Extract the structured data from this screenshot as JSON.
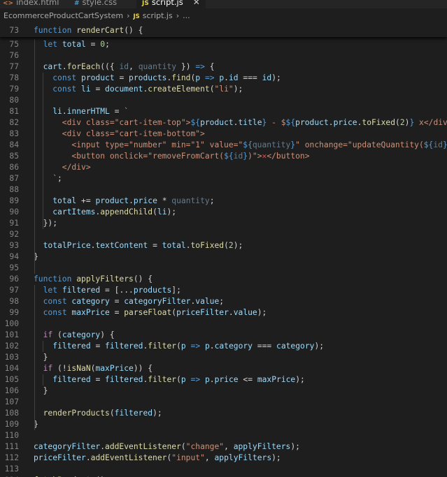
{
  "tabs": [
    {
      "icon": "<>",
      "name": "index.html"
    },
    {
      "icon": "#",
      "name": "style.css"
    },
    {
      "icon": "JS",
      "name": "script.js",
      "close": "✕"
    }
  ],
  "breadcrumb": {
    "folder": "EcommerceProductCartSystem",
    "file_icon": "JS",
    "file": "script.js",
    "more": "..."
  },
  "code_lines": [
    {
      "n": "73",
      "t": [
        [
          "k",
          "function "
        ],
        [
          "f",
          "renderCart"
        ],
        [
          "p",
          "() {"
        ]
      ]
    },
    {
      "n": "75",
      "t": [
        [
          "p",
          "  "
        ],
        [
          "k",
          "let "
        ],
        [
          "v",
          "total"
        ],
        [
          "p",
          " = "
        ],
        [
          "n",
          "0"
        ],
        [
          "p",
          ";"
        ]
      ]
    },
    {
      "n": "76",
      "t": []
    },
    {
      "n": "77",
      "t": [
        [
          "p",
          "  "
        ],
        [
          "v",
          "cart"
        ],
        [
          "p",
          "."
        ],
        [
          "f",
          "forEach"
        ],
        [
          "p",
          "(({ "
        ],
        [
          "dim",
          "id"
        ],
        [
          "p",
          ", "
        ],
        [
          "dim",
          "quantity"
        ],
        [
          "p",
          " }) "
        ],
        [
          "k",
          "=>"
        ],
        [
          "p",
          " {"
        ]
      ]
    },
    {
      "n": "78",
      "t": [
        [
          "p",
          "    "
        ],
        [
          "k",
          "const "
        ],
        [
          "v",
          "product"
        ],
        [
          "p",
          " = "
        ],
        [
          "v",
          "products"
        ],
        [
          "p",
          "."
        ],
        [
          "f",
          "find"
        ],
        [
          "p",
          "("
        ],
        [
          "v",
          "p"
        ],
        [
          "p",
          " "
        ],
        [
          "k",
          "=>"
        ],
        [
          "p",
          " "
        ],
        [
          "v",
          "p"
        ],
        [
          "p",
          "."
        ],
        [
          "v",
          "id"
        ],
        [
          "p",
          " === "
        ],
        [
          "v",
          "id"
        ],
        [
          "p",
          ");"
        ]
      ]
    },
    {
      "n": "79",
      "t": [
        [
          "p",
          "    "
        ],
        [
          "k",
          "const "
        ],
        [
          "v",
          "li"
        ],
        [
          "p",
          " = "
        ],
        [
          "v",
          "document"
        ],
        [
          "p",
          "."
        ],
        [
          "f",
          "createElement"
        ],
        [
          "p",
          "("
        ],
        [
          "s",
          "\"li\""
        ],
        [
          "p",
          ");"
        ]
      ]
    },
    {
      "n": "80",
      "t": []
    },
    {
      "n": "81",
      "t": [
        [
          "p",
          "    "
        ],
        [
          "v",
          "li"
        ],
        [
          "p",
          "."
        ],
        [
          "v",
          "innerHTML"
        ],
        [
          "p",
          " = "
        ],
        [
          "s",
          "`"
        ]
      ]
    },
    {
      "n": "82",
      "t": [
        [
          "s",
          "      <div class=\"cart-item-top\">"
        ],
        [
          "k",
          "${"
        ],
        [
          "v",
          "product"
        ],
        [
          "p",
          "."
        ],
        [
          "v",
          "title"
        ],
        [
          "k",
          "}"
        ],
        [
          "s",
          " - $"
        ],
        [
          "k",
          "${"
        ],
        [
          "v",
          "product"
        ],
        [
          "p",
          "."
        ],
        [
          "v",
          "price"
        ],
        [
          "p",
          "."
        ],
        [
          "f",
          "toFixed"
        ],
        [
          "p",
          "("
        ],
        [
          "n",
          "2"
        ],
        [
          "p",
          ")"
        ],
        [
          "k",
          "}"
        ],
        [
          "s",
          " x</div>"
        ]
      ]
    },
    {
      "n": "83",
      "t": [
        [
          "s",
          "      <div class=\"cart-item-bottom\">"
        ]
      ]
    },
    {
      "n": "84",
      "t": [
        [
          "s",
          "        <input type=\"number\" min=\"1\" value=\""
        ],
        [
          "k",
          "${"
        ],
        [
          "dim",
          "quantity"
        ],
        [
          "k",
          "}"
        ],
        [
          "s",
          "\" onchange=\"updateQuantity("
        ],
        [
          "k",
          "${"
        ],
        [
          "dim",
          "id"
        ],
        [
          "k",
          "}"
        ],
        [
          "s",
          ", this"
        ]
      ]
    },
    {
      "n": "85",
      "t": [
        [
          "s",
          "        <button onclick=\"removeFromCart("
        ],
        [
          "k",
          "${"
        ],
        [
          "dim",
          "id"
        ],
        [
          "k",
          "}"
        ],
        [
          "s",
          ")\">"
        ],
        [
          "x-red",
          "✕"
        ],
        [
          "s",
          "</button>"
        ]
      ]
    },
    {
      "n": "86",
      "t": [
        [
          "s",
          "      </div>"
        ]
      ]
    },
    {
      "n": "87",
      "t": [
        [
          "s",
          "    `"
        ],
        [
          "p",
          ";"
        ]
      ]
    },
    {
      "n": "88",
      "t": []
    },
    {
      "n": "89",
      "t": [
        [
          "p",
          "    "
        ],
        [
          "v",
          "total"
        ],
        [
          "p",
          " += "
        ],
        [
          "v",
          "product"
        ],
        [
          "p",
          "."
        ],
        [
          "v",
          "price"
        ],
        [
          "p",
          " * "
        ],
        [
          "dim",
          "quantity"
        ],
        [
          "p",
          ";"
        ]
      ]
    },
    {
      "n": "90",
      "t": [
        [
          "p",
          "    "
        ],
        [
          "v",
          "cartItems"
        ],
        [
          "p",
          "."
        ],
        [
          "f",
          "appendChild"
        ],
        [
          "p",
          "("
        ],
        [
          "v",
          "li"
        ],
        [
          "p",
          ");"
        ]
      ]
    },
    {
      "n": "91",
      "t": [
        [
          "p",
          "  });"
        ]
      ]
    },
    {
      "n": "92",
      "t": []
    },
    {
      "n": "93",
      "t": [
        [
          "p",
          "  "
        ],
        [
          "v",
          "totalPrice"
        ],
        [
          "p",
          "."
        ],
        [
          "v",
          "textContent"
        ],
        [
          "p",
          " = "
        ],
        [
          "v",
          "total"
        ],
        [
          "p",
          "."
        ],
        [
          "f",
          "toFixed"
        ],
        [
          "p",
          "("
        ],
        [
          "n",
          "2"
        ],
        [
          "p",
          ");"
        ]
      ]
    },
    {
      "n": "94",
      "t": [
        [
          "p",
          "}"
        ]
      ]
    },
    {
      "n": "95",
      "t": []
    },
    {
      "n": "96",
      "t": [
        [
          "k",
          "function "
        ],
        [
          "f",
          "applyFilters"
        ],
        [
          "p",
          "() {"
        ]
      ]
    },
    {
      "n": "97",
      "t": [
        [
          "p",
          "  "
        ],
        [
          "k",
          "let "
        ],
        [
          "v",
          "filtered"
        ],
        [
          "p",
          " = [..."
        ],
        [
          "v",
          "products"
        ],
        [
          "p",
          "];"
        ]
      ]
    },
    {
      "n": "98",
      "t": [
        [
          "p",
          "  "
        ],
        [
          "k",
          "const "
        ],
        [
          "v",
          "category"
        ],
        [
          "p",
          " = "
        ],
        [
          "v",
          "categoryFilter"
        ],
        [
          "p",
          "."
        ],
        [
          "v",
          "value"
        ],
        [
          "p",
          ";"
        ]
      ]
    },
    {
      "n": "99",
      "t": [
        [
          "p",
          "  "
        ],
        [
          "k",
          "const "
        ],
        [
          "v",
          "maxPrice"
        ],
        [
          "p",
          " = "
        ],
        [
          "f",
          "parseFloat"
        ],
        [
          "p",
          "("
        ],
        [
          "v",
          "priceFilter"
        ],
        [
          "p",
          "."
        ],
        [
          "v",
          "value"
        ],
        [
          "p",
          ");"
        ]
      ]
    },
    {
      "n": "100",
      "t": []
    },
    {
      "n": "101",
      "t": [
        [
          "p",
          "  "
        ],
        [
          "ctl",
          "if"
        ],
        [
          "p",
          " ("
        ],
        [
          "v",
          "category"
        ],
        [
          "p",
          ") {"
        ]
      ]
    },
    {
      "n": "102",
      "t": [
        [
          "p",
          "    "
        ],
        [
          "v",
          "filtered"
        ],
        [
          "p",
          " = "
        ],
        [
          "v",
          "filtered"
        ],
        [
          "p",
          "."
        ],
        [
          "f",
          "filter"
        ],
        [
          "p",
          "("
        ],
        [
          "v",
          "p"
        ],
        [
          "p",
          " "
        ],
        [
          "k",
          "=>"
        ],
        [
          "p",
          " "
        ],
        [
          "v",
          "p"
        ],
        [
          "p",
          "."
        ],
        [
          "v",
          "category"
        ],
        [
          "p",
          " === "
        ],
        [
          "v",
          "category"
        ],
        [
          "p",
          ");"
        ]
      ]
    },
    {
      "n": "103",
      "t": [
        [
          "p",
          "  }"
        ]
      ]
    },
    {
      "n": "104",
      "t": [
        [
          "p",
          "  "
        ],
        [
          "ctl",
          "if"
        ],
        [
          "p",
          " (!"
        ],
        [
          "f",
          "isNaN"
        ],
        [
          "p",
          "("
        ],
        [
          "v",
          "maxPrice"
        ],
        [
          "p",
          ")) {"
        ]
      ]
    },
    {
      "n": "105",
      "t": [
        [
          "p",
          "    "
        ],
        [
          "v",
          "filtered"
        ],
        [
          "p",
          " = "
        ],
        [
          "v",
          "filtered"
        ],
        [
          "p",
          "."
        ],
        [
          "f",
          "filter"
        ],
        [
          "p",
          "("
        ],
        [
          "v",
          "p"
        ],
        [
          "p",
          " "
        ],
        [
          "k",
          "=>"
        ],
        [
          "p",
          " "
        ],
        [
          "v",
          "p"
        ],
        [
          "p",
          "."
        ],
        [
          "v",
          "price"
        ],
        [
          "p",
          " <= "
        ],
        [
          "v",
          "maxPrice"
        ],
        [
          "p",
          ");"
        ]
      ]
    },
    {
      "n": "106",
      "t": [
        [
          "p",
          "  }"
        ]
      ]
    },
    {
      "n": "107",
      "t": []
    },
    {
      "n": "108",
      "t": [
        [
          "p",
          "  "
        ],
        [
          "f",
          "renderProducts"
        ],
        [
          "p",
          "("
        ],
        [
          "v",
          "filtered"
        ],
        [
          "p",
          ");"
        ]
      ]
    },
    {
      "n": "109",
      "t": [
        [
          "p",
          "}"
        ]
      ]
    },
    {
      "n": "110",
      "t": []
    },
    {
      "n": "111",
      "t": [
        [
          "v",
          "categoryFilter"
        ],
        [
          "p",
          "."
        ],
        [
          "f",
          "addEventListener"
        ],
        [
          "p",
          "("
        ],
        [
          "s",
          "\"change\""
        ],
        [
          "p",
          ", "
        ],
        [
          "v",
          "applyFilters"
        ],
        [
          "p",
          ");"
        ]
      ]
    },
    {
      "n": "112",
      "t": [
        [
          "v",
          "priceFilter"
        ],
        [
          "p",
          "."
        ],
        [
          "f",
          "addEventListener"
        ],
        [
          "p",
          "("
        ],
        [
          "s",
          "\"input\""
        ],
        [
          "p",
          ", "
        ],
        [
          "v",
          "applyFilters"
        ],
        [
          "p",
          ");"
        ]
      ]
    },
    {
      "n": "113",
      "t": []
    },
    {
      "n": "114",
      "t": [
        [
          "f",
          "fetchProducts"
        ],
        [
          "p",
          "();"
        ]
      ]
    }
  ]
}
